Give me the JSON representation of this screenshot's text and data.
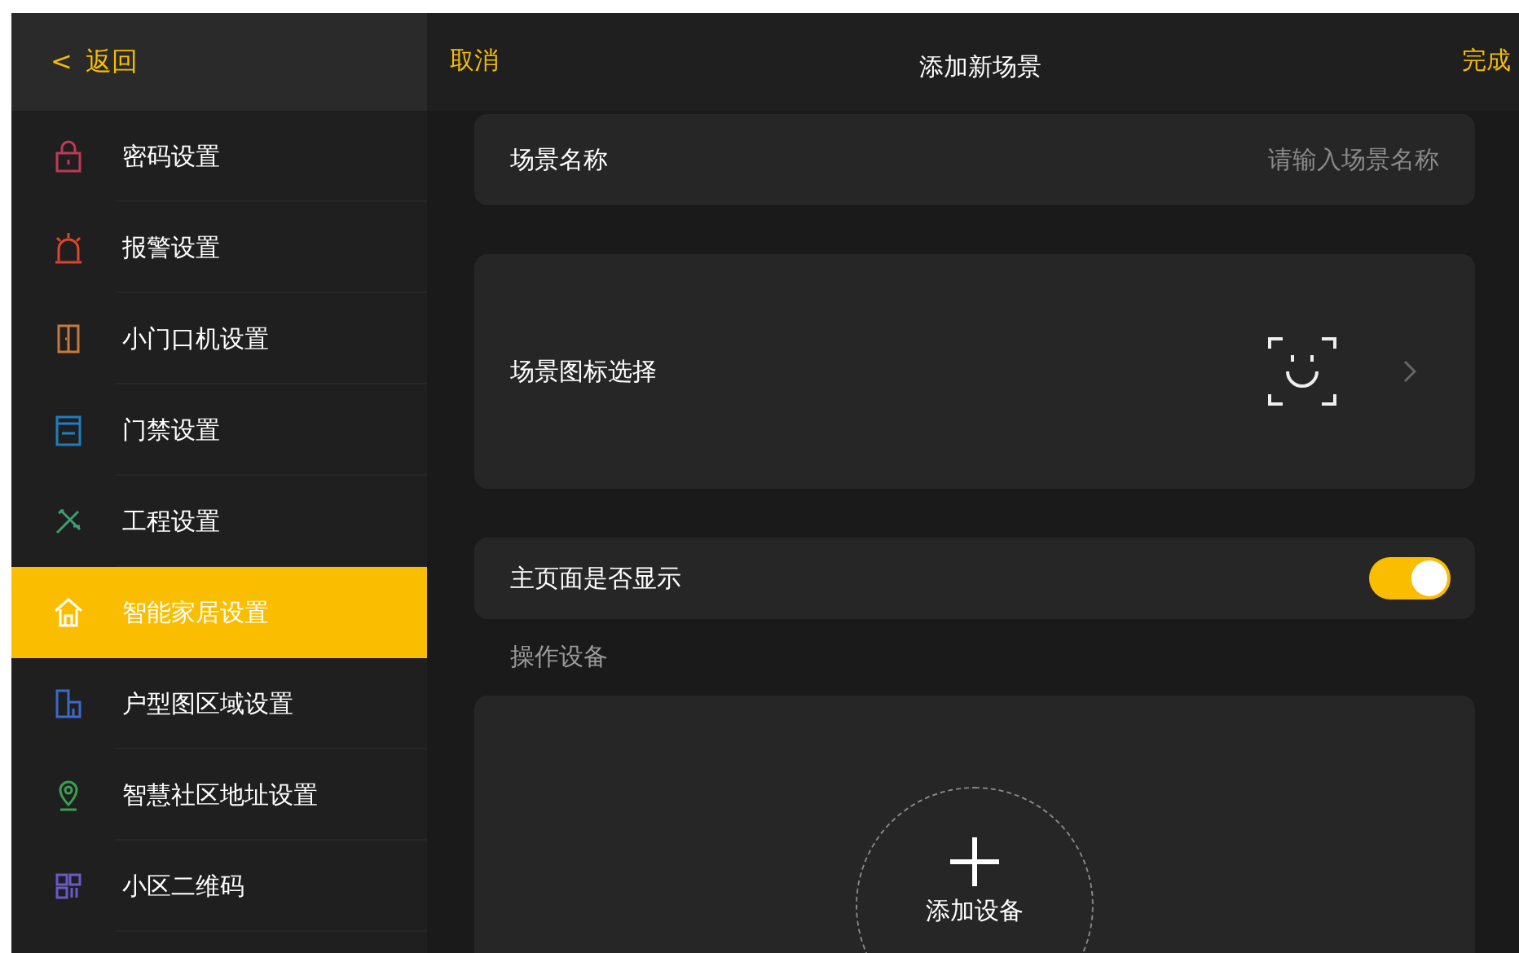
{
  "sidebar": {
    "back": {
      "icon": "<",
      "label": "返回"
    },
    "items": [
      {
        "kind": "lock",
        "label": "密码设置",
        "color": "#c0395a",
        "selected": false
      },
      {
        "kind": "alarm",
        "label": "报警设置",
        "color": "#e0452b",
        "selected": false
      },
      {
        "kind": "door",
        "label": "小门口机设置",
        "color": "#c87a3a",
        "selected": false
      },
      {
        "kind": "access",
        "label": "门禁设置",
        "color": "#1e7fc0",
        "selected": false
      },
      {
        "kind": "tools",
        "label": "工程设置",
        "color": "#3aa070",
        "selected": false
      },
      {
        "kind": "home",
        "label": "智能家居设置",
        "color": "#ffffff",
        "selected": true
      },
      {
        "kind": "floorplan",
        "label": "户型图区域设置",
        "color": "#3a6ad0",
        "selected": false
      },
      {
        "kind": "pin",
        "label": "智慧社区地址设置",
        "color": "#3aa050",
        "selected": false
      },
      {
        "kind": "qrcode",
        "label": "小区二维码",
        "color": "#6a5ac8",
        "selected": false
      }
    ]
  },
  "header": {
    "cancel": "取消",
    "title": "添加新场景",
    "done": "完成"
  },
  "name_row": {
    "label": "场景名称",
    "placeholder": "请输入场景名称"
  },
  "icon_row": {
    "label": "场景图标选择"
  },
  "show_row": {
    "label": "主页面是否显示",
    "on": true
  },
  "devices": {
    "label": "操作设备",
    "add": "添加设备"
  }
}
